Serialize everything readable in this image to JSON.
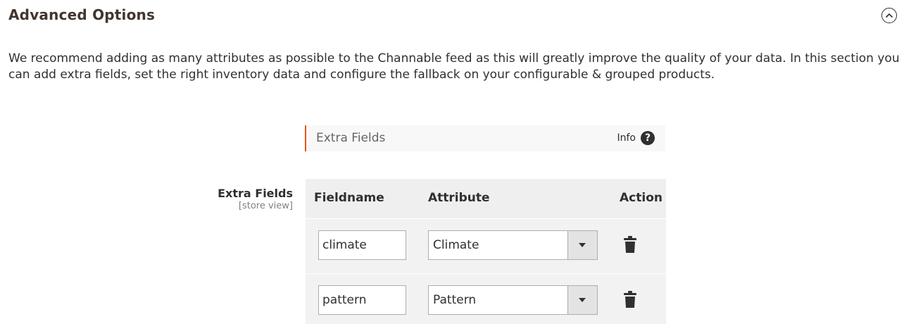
{
  "section": {
    "title": "Advanced Options",
    "collapse_icon": "chevron-up-circle-icon",
    "description": "We recommend adding as many attributes as possible to the Channable feed as this will greatly improve the quality of your data. In this section you can add extra fields, set the right inventory data and configure the fallback on your configurable & grouped products."
  },
  "subheader": {
    "title": "Extra Fields",
    "info_label": "Info",
    "help_icon_glyph": "?"
  },
  "field": {
    "label": "Extra Fields",
    "scope": "[store view]"
  },
  "grid": {
    "headers": {
      "fieldname": "Fieldname",
      "attribute": "Attribute",
      "action": "Action"
    },
    "rows": [
      {
        "fieldname": "climate",
        "attribute": "Climate"
      },
      {
        "fieldname": "pattern",
        "attribute": "Pattern"
      }
    ]
  },
  "colors": {
    "accent": "#eb5202",
    "header_bg": "#efefef",
    "row_bg": "#f2f2f2"
  }
}
